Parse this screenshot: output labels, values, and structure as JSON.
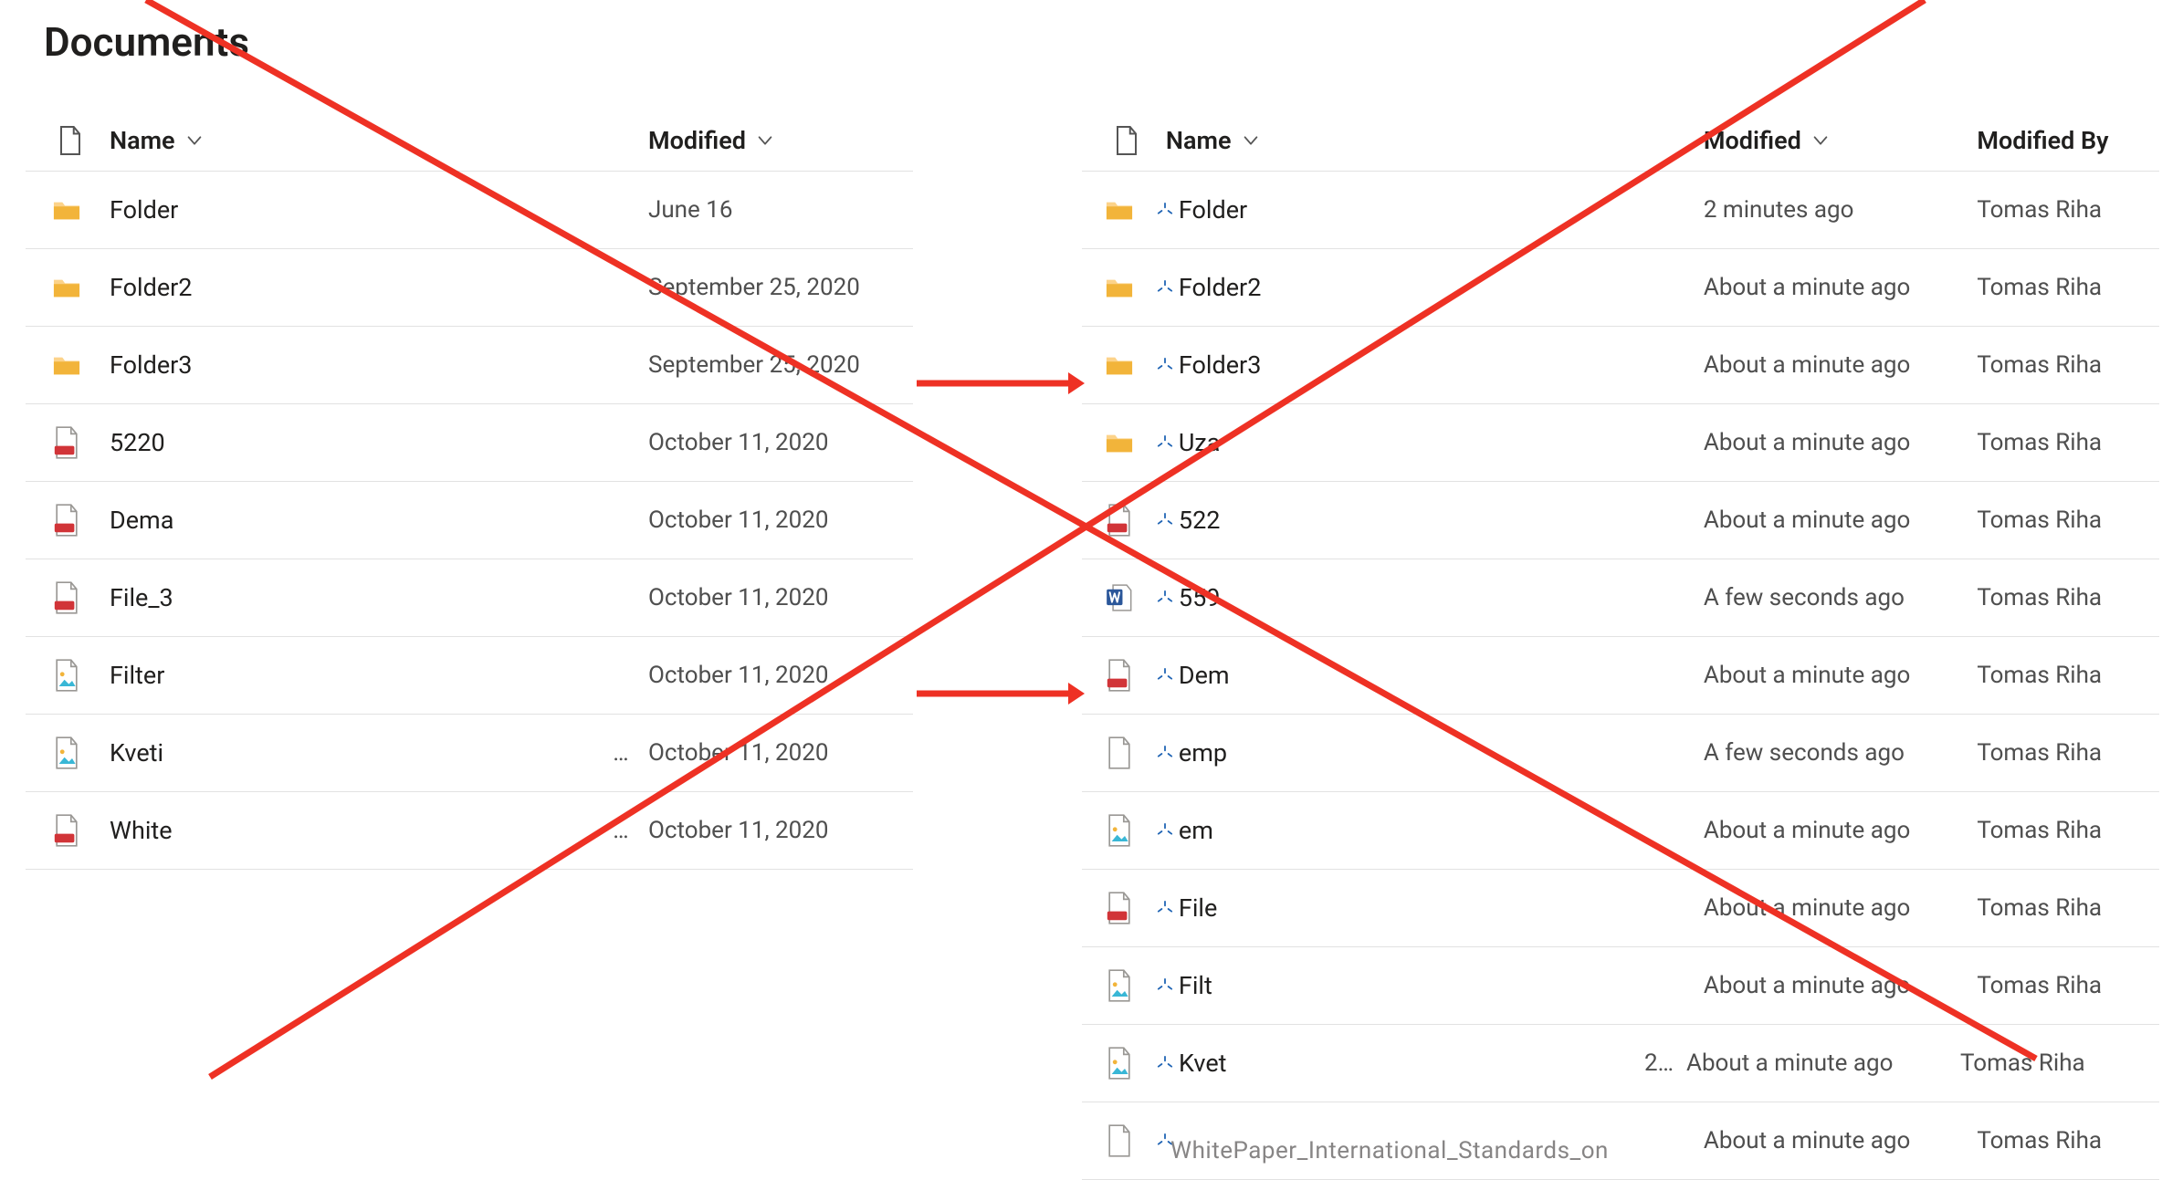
{
  "title": "Documents",
  "columns": {
    "name": "Name",
    "modified": "Modified",
    "modified_by": "Modified By"
  },
  "left_rows": [
    {
      "icon": "folder",
      "name": "Folder",
      "modified": "June 16"
    },
    {
      "icon": "folder",
      "name": "Folder2",
      "modified": "September 25, 2020"
    },
    {
      "icon": "folder",
      "name": "Folder3",
      "modified": "September 25, 2020"
    },
    {
      "icon": "pdf",
      "name": "5220",
      "modified": "October 11, 2020"
    },
    {
      "icon": "pdf",
      "name": "Dema",
      "modified": "October 11, 2020"
    },
    {
      "icon": "pdf",
      "name": "File_3",
      "modified": "October 11, 2020"
    },
    {
      "icon": "image",
      "name": "Filter",
      "modified": "October 11, 2020"
    },
    {
      "icon": "image",
      "name": "Kveti",
      "modified": "October 11, 2020",
      "ell": true
    },
    {
      "icon": "pdf",
      "name": "White",
      "modified": "October 11, 2020",
      "ell": true
    }
  ],
  "right_rows": [
    {
      "icon": "folder",
      "name": "Folder",
      "modified": "2 minutes ago",
      "by": "Tomas Riha",
      "tick": true
    },
    {
      "icon": "folder",
      "name": "Folder2",
      "modified": "About a minute ago",
      "by": "Tomas Riha",
      "tick": true
    },
    {
      "icon": "folder",
      "name": "Folder3",
      "modified": "About a minute ago",
      "by": "Tomas Riha",
      "tick": true
    },
    {
      "icon": "folder",
      "name": "Uza",
      "modified": "About a minute ago",
      "by": "Tomas Riha",
      "tick": true
    },
    {
      "icon": "pdf",
      "name": "522",
      "modified": "About a minute ago",
      "by": "Tomas Riha",
      "tick": true
    },
    {
      "icon": "word",
      "name": "559",
      "modified": "A few seconds ago",
      "by": "Tomas Riha",
      "tick": true
    },
    {
      "icon": "pdf",
      "name": "Dem",
      "modified": "About a minute ago",
      "by": "Tomas Riha",
      "tick": true
    },
    {
      "icon": "blank",
      "name": "emp",
      "modified": "A few seconds ago",
      "by": "Tomas Riha",
      "tick": true
    },
    {
      "icon": "image",
      "name": "em",
      "modified": "About a minute ago",
      "by": "Tomas Riha",
      "tick": true
    },
    {
      "icon": "pdf",
      "name": "File",
      "modified": "About a minute ago",
      "by": "Tomas Riha",
      "tick": true
    },
    {
      "icon": "image",
      "name": "Filt",
      "modified": "About a minute ago",
      "by": "Tomas Riha",
      "tick": true
    },
    {
      "icon": "image",
      "name": "Kvet",
      "modified": "About a minute ago",
      "by": "Tomas Riha",
      "tick": true,
      "ell": "2…"
    },
    {
      "icon": "blank",
      "name": "",
      "modified": "About a minute ago",
      "by": "Tomas Riha",
      "tick": true
    }
  ],
  "long_filename_partial": "WhitePaper_International_Standards_on",
  "overlay": {
    "big_x_color": "#ee3124",
    "arrow_color": "#ee3124"
  }
}
